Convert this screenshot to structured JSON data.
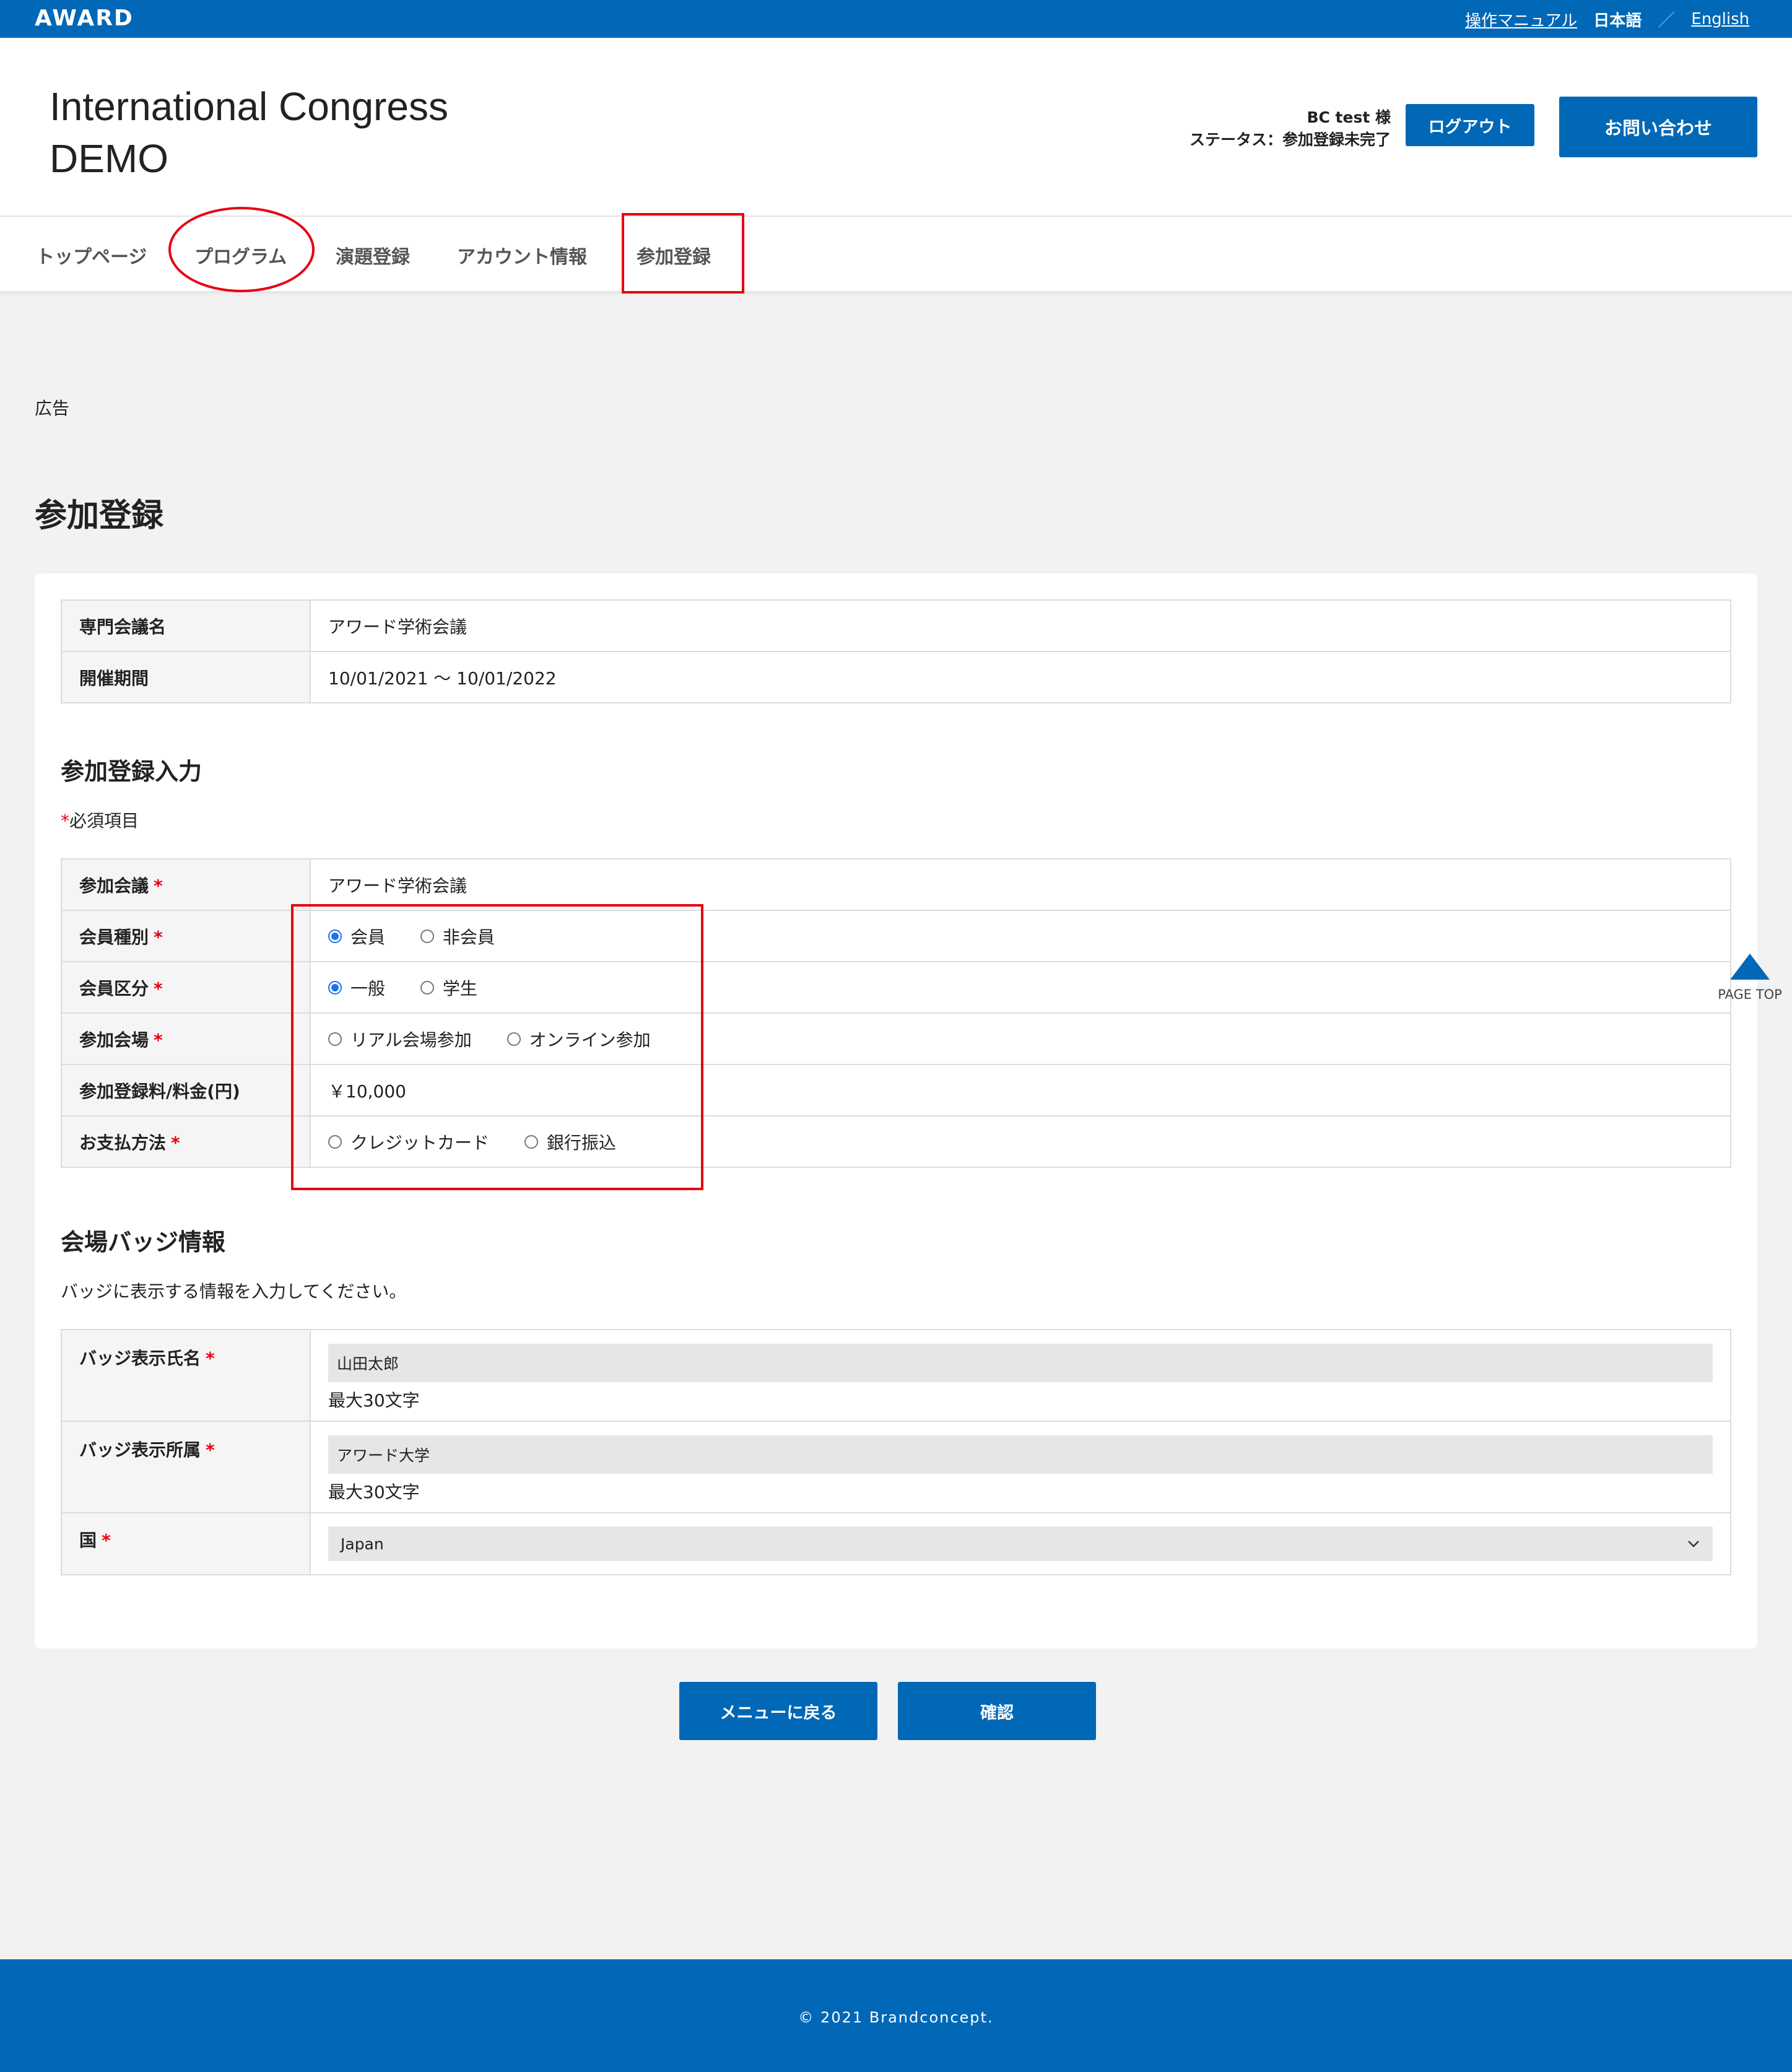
{
  "topbar": {
    "logo": "AWARD",
    "manual_link": "操作マニュアル",
    "lang_ja": "日本語",
    "lang_sep": "／",
    "lang_en": "English"
  },
  "header": {
    "title_line1": "International Congress",
    "title_line2": "DEMO",
    "user_name": "BC test 様",
    "user_status": "ステータス：参加登録未完了",
    "logout_label": "ログアウト",
    "contact_label": "お問い合わせ"
  },
  "nav": {
    "items": [
      "トップページ",
      "プログラム",
      "演題登録",
      "アカウント情報",
      "参加登録"
    ]
  },
  "ad_label": "広告",
  "page_title": "参加登録",
  "conference_info": {
    "rows": [
      {
        "label": "専門会議名",
        "value": "アワード学術会議"
      },
      {
        "label": "開催期間",
        "value": "10/01/2021 〜 10/01/2022"
      }
    ]
  },
  "registration": {
    "section_title": "参加登録入力",
    "required_mark": "*",
    "required_note": "必須項目",
    "conference": {
      "label": "参加会議",
      "value": "アワード学術会議"
    },
    "member_type": {
      "label": "会員種別",
      "options": [
        "会員",
        "非会員"
      ],
      "selected": 0
    },
    "member_class": {
      "label": "会員区分",
      "options": [
        "一般",
        "学生"
      ],
      "selected": 0
    },
    "venue": {
      "label": "参加会場",
      "options": [
        "リアル会場参加",
        "オンライン参加"
      ],
      "selected": null
    },
    "fee": {
      "label": "参加登録料/料金(円)",
      "value": "￥10,000"
    },
    "payment": {
      "label": "お支払方法",
      "options": [
        "クレジットカード",
        "銀行振込"
      ],
      "selected": null
    }
  },
  "badge": {
    "section_title": "会場バッジ情報",
    "description": "バッジに表示する情報を入力してください。",
    "name": {
      "label": "バッジ表示氏名",
      "value": "山田太郎",
      "hint": "最大30文字"
    },
    "affiliation": {
      "label": "バッジ表示所属",
      "value": "アワード大学",
      "hint": "最大30文字"
    },
    "country": {
      "label": "国",
      "value": "Japan"
    }
  },
  "buttons": {
    "back": "メニューに戻る",
    "confirm": "確認"
  },
  "page_top_label": "PAGE TOP",
  "footer": {
    "copyright": "© 2021 Brandconcept."
  },
  "colors": {
    "primary": "#0068b7",
    "required": "#e60012",
    "annotation": "#e60012"
  }
}
